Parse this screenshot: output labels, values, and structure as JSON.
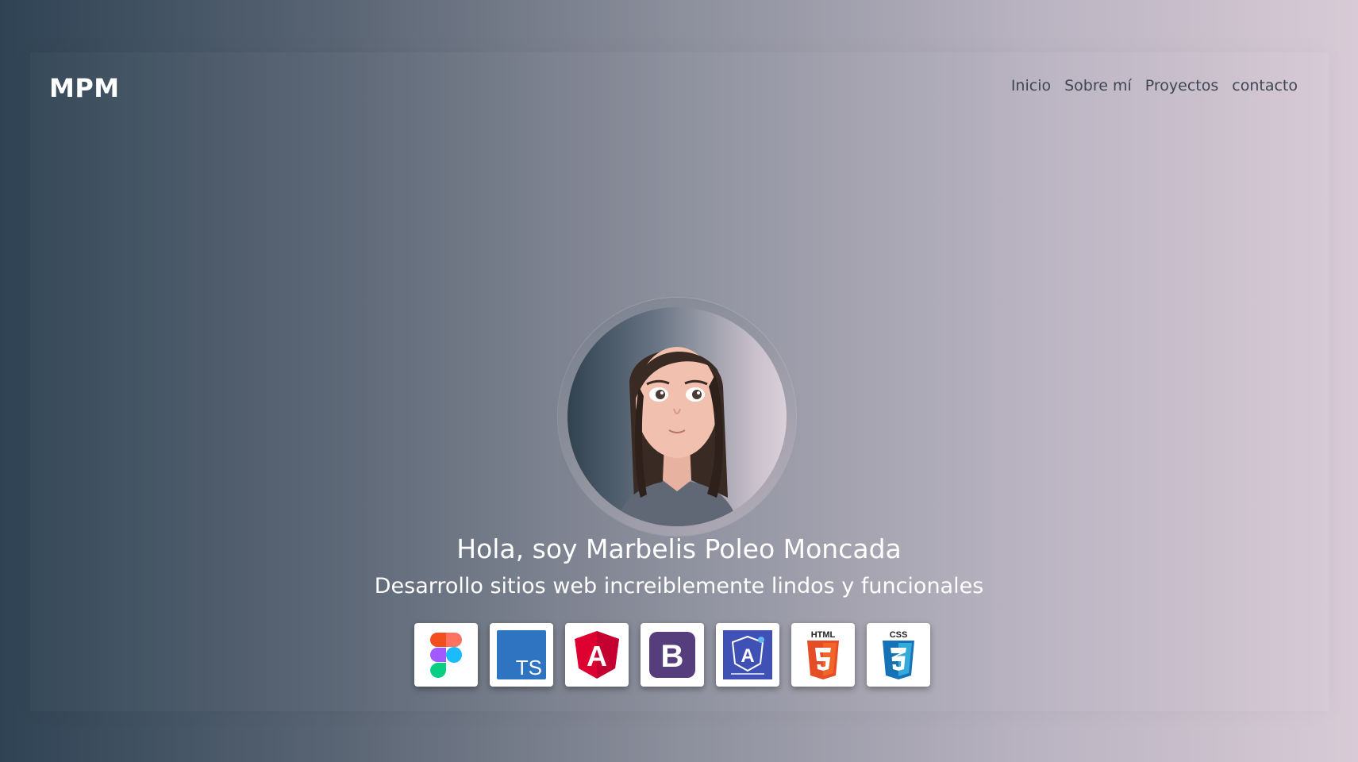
{
  "header": {
    "brand": "MPM",
    "nav": [
      "Inicio",
      "Sobre mí",
      "Proyectos",
      "contacto"
    ]
  },
  "hero": {
    "title": "Hola, soy Marbelis Poleo Moncada",
    "subtitle": "Desarrollo sitios web increiblemente lindos y funcionales",
    "avatar": "cartoon-woman-avatar"
  },
  "technologies": [
    {
      "name": "figma-icon"
    },
    {
      "name": "typescript-icon",
      "label": "TS"
    },
    {
      "name": "angular-icon",
      "label": "A"
    },
    {
      "name": "bootstrap-icon",
      "label": "B"
    },
    {
      "name": "angular-material-icon",
      "label": "A"
    },
    {
      "name": "html5-icon",
      "label": "HTML"
    },
    {
      "name": "css3-icon",
      "label": "CSS"
    }
  ],
  "colors": {
    "gradient_start": "#2f4354",
    "gradient_end": "#d8cbd6",
    "nav_text": "#3f4652",
    "hero_text": "#ffffff"
  }
}
